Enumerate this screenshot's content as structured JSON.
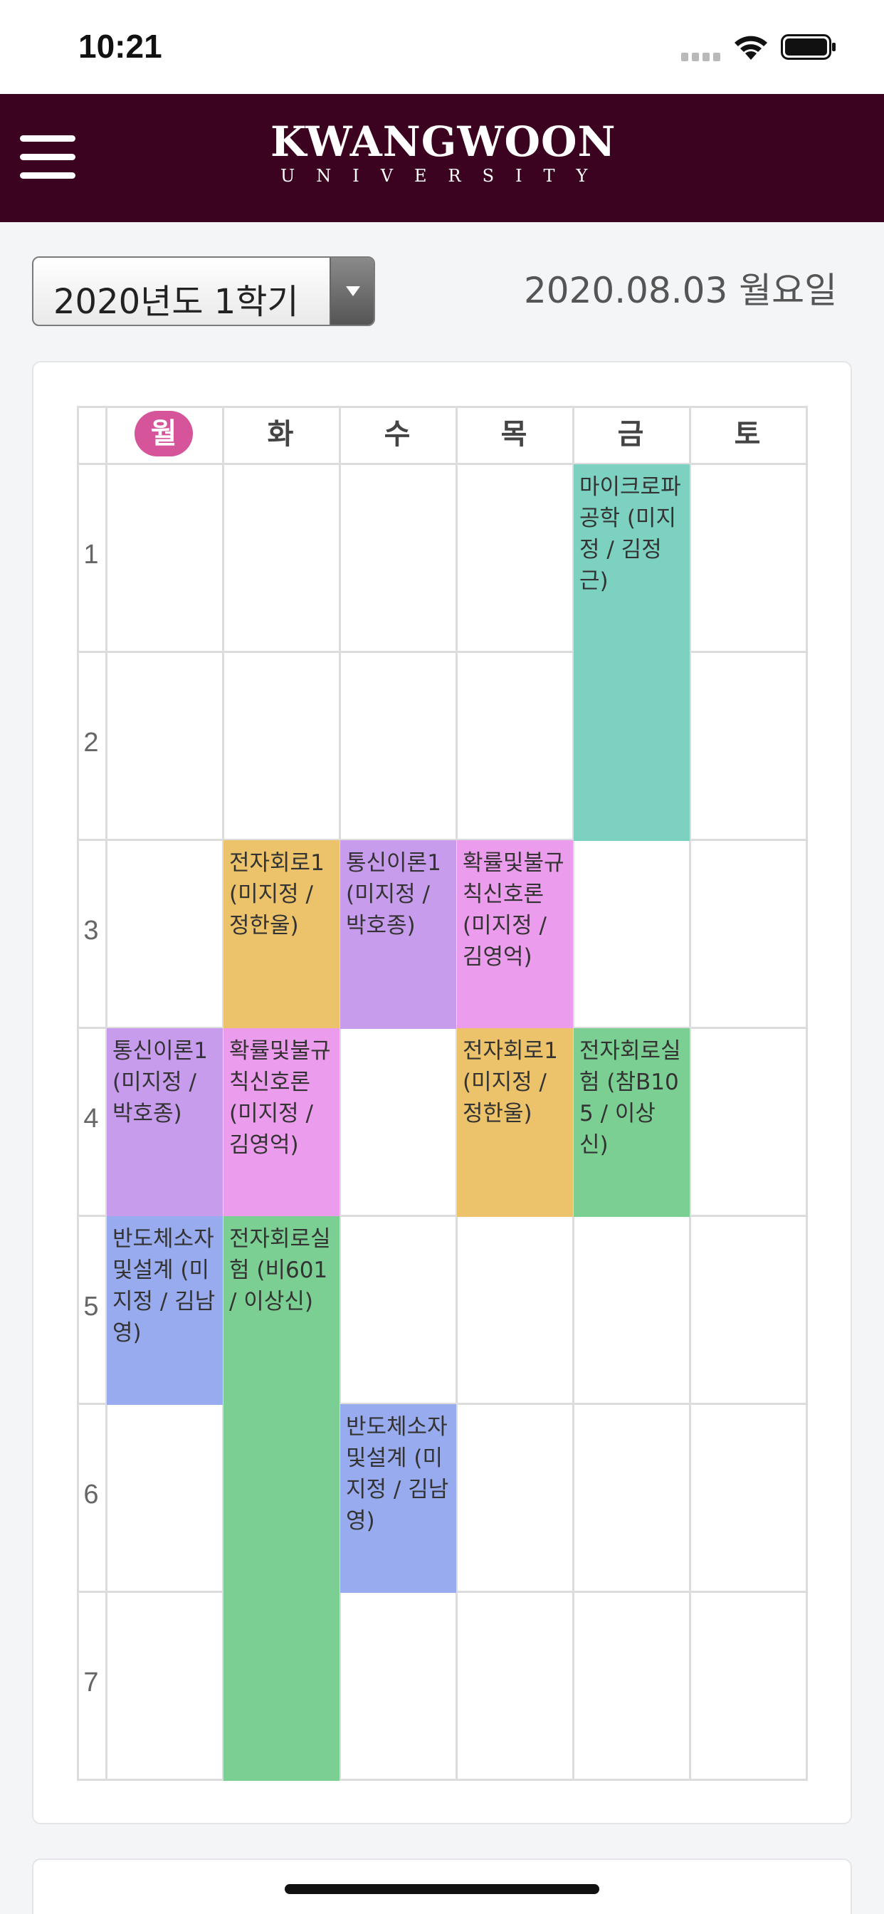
{
  "status_bar": {
    "time": "10:21"
  },
  "header": {
    "brand_name": "KWANGWOON",
    "brand_sub": "UNIVERSITY"
  },
  "semester": {
    "selected": "2020년도 1학기"
  },
  "date": "2020.08.03 월요일",
  "timetable": {
    "today_index": 0,
    "days": [
      "월",
      "화",
      "수",
      "목",
      "금",
      "토"
    ],
    "periods": [
      "1",
      "2",
      "3",
      "4",
      "5",
      "6",
      "7"
    ],
    "lectures": [
      {
        "text": "마이크로파공학 (미지정 / 김정근)",
        "day": 4,
        "start": 1,
        "end": 2,
        "color": "#7dd1c0"
      },
      {
        "text": "전자회로1 (미지정 / 정한울)",
        "day": 1,
        "start": 3,
        "end": 3,
        "color": "#ecc36a"
      },
      {
        "text": "통신이론1 (미지정 / 박호종)",
        "day": 2,
        "start": 3,
        "end": 3,
        "color": "#c89ced"
      },
      {
        "text": "확률및불규칙신호론 (미지정 / 김영억)",
        "day": 3,
        "start": 3,
        "end": 3,
        "color": "#ec9cec"
      },
      {
        "text": "통신이론1 (미지정 / 박호종)",
        "day": 0,
        "start": 4,
        "end": 4,
        "color": "#c89ced"
      },
      {
        "text": "확률및불규칙신호론 (미지정 / 김영억)",
        "day": 1,
        "start": 4,
        "end": 4,
        "color": "#ec9cec"
      },
      {
        "text": "전자회로1 (미지정 / 정한울)",
        "day": 3,
        "start": 4,
        "end": 4,
        "color": "#ecc36a"
      },
      {
        "text": "전자회로실험 (참B105 / 이상신)",
        "day": 4,
        "start": 4,
        "end": 4,
        "color": "#7ccf93"
      },
      {
        "text": "반도체소자및설계 (미지정 / 김남영)",
        "day": 0,
        "start": 5,
        "end": 5,
        "color": "#98abee"
      },
      {
        "text": "전자회로실험 (비601 / 이상신)",
        "day": 1,
        "start": 5,
        "end": 7,
        "color": "#7ccf93"
      },
      {
        "text": "반도체소자및설계 (미지정 / 김남영)",
        "day": 2,
        "start": 6,
        "end": 6,
        "color": "#98abee"
      }
    ]
  }
}
